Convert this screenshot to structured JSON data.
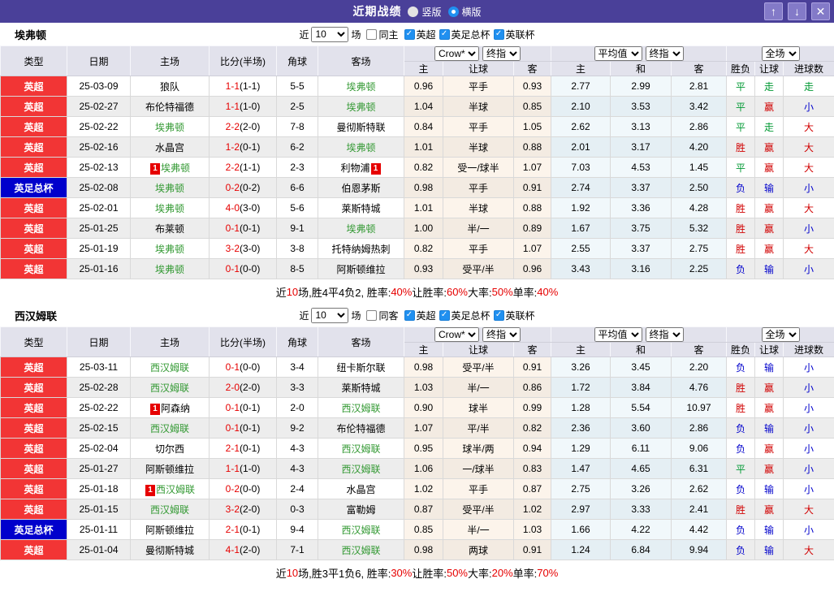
{
  "titlebar": {
    "title": "近期战绩",
    "vertical_label": "竖版",
    "horizontal_label": "横版",
    "vertical_selected": false,
    "horizontal_selected": true,
    "buttons": [
      {
        "name": "scroll-up",
        "glyph": "↑"
      },
      {
        "name": "scroll-down",
        "glyph": "↓"
      },
      {
        "name": "close",
        "glyph": "✕"
      }
    ]
  },
  "table": {
    "main_columns": [
      "类型",
      "日期",
      "主场",
      "比分(半场)",
      "角球",
      "客场"
    ],
    "sub_columns": [
      "主",
      "让球",
      "客",
      "主",
      "和",
      "客",
      "胜负",
      "让球",
      "进球数"
    ],
    "dropdowns": {
      "company": "Crow*",
      "company_type": "终指",
      "average": "平均值",
      "average_type": "终指",
      "scope": "全场"
    }
  },
  "colors": {
    "titlebar_purple": "#4a4099",
    "league_red": "#f23535",
    "cup_blue": "#0000cc",
    "team_green": "#339933",
    "score_red": "#e60000",
    "win_red": "#d10000",
    "draw_green": "#009933",
    "lose_blue": "#0000cc"
  },
  "sections": [
    {
      "team": "埃弗顿",
      "filter": {
        "near": "近",
        "count": "10",
        "unit": "场",
        "same": "同主",
        "same_checked": false,
        "leagues": [
          {
            "label": "英超",
            "checked": true
          },
          {
            "label": "英足总杯",
            "checked": true
          },
          {
            "label": "英联杯",
            "checked": true
          }
        ]
      },
      "rows": [
        {
          "league": "英超",
          "league_color": "red",
          "date": "25-03-09",
          "home": "狼队",
          "home_hl": false,
          "score": "1-1",
          "half": "(1-1)",
          "corner": "5-5",
          "away": "埃弗顿",
          "away_hl": true,
          "odds": [
            "0.96",
            "平手",
            "0.93"
          ],
          "avg": [
            "2.77",
            "2.99",
            "2.81"
          ],
          "results": [
            {
              "t": "平",
              "c": "g"
            },
            {
              "t": "走",
              "c": "g"
            },
            {
              "t": "走",
              "c": "g"
            }
          ]
        },
        {
          "league": "英超",
          "league_color": "red",
          "date": "25-02-27",
          "home": "布伦特福德",
          "home_hl": false,
          "score": "1-1",
          "half": "(1-0)",
          "corner": "2-5",
          "away": "埃弗顿",
          "away_hl": true,
          "odds": [
            "1.04",
            "半球",
            "0.85"
          ],
          "avg": [
            "2.10",
            "3.53",
            "3.42"
          ],
          "results": [
            {
              "t": "平",
              "c": "g"
            },
            {
              "t": "赢",
              "c": "r"
            },
            {
              "t": "小",
              "c": "b"
            }
          ]
        },
        {
          "league": "英超",
          "league_color": "red",
          "date": "25-02-22",
          "home": "埃弗顿",
          "home_hl": true,
          "score": "2-2",
          "half": "(2-0)",
          "corner": "7-8",
          "away": "曼彻斯特联",
          "away_hl": false,
          "odds": [
            "0.84",
            "平手",
            "1.05"
          ],
          "avg": [
            "2.62",
            "3.13",
            "2.86"
          ],
          "results": [
            {
              "t": "平",
              "c": "g"
            },
            {
              "t": "走",
              "c": "g"
            },
            {
              "t": "大",
              "c": "r"
            }
          ]
        },
        {
          "league": "英超",
          "league_color": "red",
          "date": "25-02-16",
          "home": "水晶宫",
          "home_hl": false,
          "score": "1-2",
          "half": "(0-1)",
          "corner": "6-2",
          "away": "埃弗顿",
          "away_hl": true,
          "odds": [
            "1.01",
            "半球",
            "0.88"
          ],
          "avg": [
            "2.01",
            "3.17",
            "4.20"
          ],
          "results": [
            {
              "t": "胜",
              "c": "r"
            },
            {
              "t": "赢",
              "c": "r"
            },
            {
              "t": "大",
              "c": "r"
            }
          ]
        },
        {
          "league": "英超",
          "league_color": "red",
          "date": "25-02-13",
          "home": "埃弗顿",
          "home_hl": true,
          "home_card": "1",
          "score": "2-2",
          "half": "(1-1)",
          "corner": "2-3",
          "away": "利物浦",
          "away_hl": false,
          "away_card": "1",
          "odds": [
            "0.82",
            "受一/球半",
            "1.07"
          ],
          "avg": [
            "7.03",
            "4.53",
            "1.45"
          ],
          "results": [
            {
              "t": "平",
              "c": "g"
            },
            {
              "t": "赢",
              "c": "r"
            },
            {
              "t": "大",
              "c": "r"
            }
          ]
        },
        {
          "league": "英足总杯",
          "league_color": "blue",
          "date": "25-02-08",
          "home": "埃弗顿",
          "home_hl": true,
          "score": "0-2",
          "half": "(0-2)",
          "corner": "6-6",
          "away": "伯恩茅斯",
          "away_hl": false,
          "odds": [
            "0.98",
            "平手",
            "0.91"
          ],
          "avg": [
            "2.74",
            "3.37",
            "2.50"
          ],
          "results": [
            {
              "t": "负",
              "c": "b"
            },
            {
              "t": "输",
              "c": "b"
            },
            {
              "t": "小",
              "c": "b"
            }
          ]
        },
        {
          "league": "英超",
          "league_color": "red",
          "date": "25-02-01",
          "home": "埃弗顿",
          "home_hl": true,
          "score": "4-0",
          "half": "(3-0)",
          "corner": "5-6",
          "away": "莱斯特城",
          "away_hl": false,
          "odds": [
            "1.01",
            "半球",
            "0.88"
          ],
          "avg": [
            "1.92",
            "3.36",
            "4.28"
          ],
          "results": [
            {
              "t": "胜",
              "c": "r"
            },
            {
              "t": "赢",
              "c": "r"
            },
            {
              "t": "大",
              "c": "r"
            }
          ]
        },
        {
          "league": "英超",
          "league_color": "red",
          "date": "25-01-25",
          "home": "布莱顿",
          "home_hl": false,
          "score": "0-1",
          "half": "(0-1)",
          "corner": "9-1",
          "away": "埃弗顿",
          "away_hl": true,
          "odds": [
            "1.00",
            "半/一",
            "0.89"
          ],
          "avg": [
            "1.67",
            "3.75",
            "5.32"
          ],
          "results": [
            {
              "t": "胜",
              "c": "r"
            },
            {
              "t": "赢",
              "c": "r"
            },
            {
              "t": "小",
              "c": "b"
            }
          ]
        },
        {
          "league": "英超",
          "league_color": "red",
          "date": "25-01-19",
          "home": "埃弗顿",
          "home_hl": true,
          "score": "3-2",
          "half": "(3-0)",
          "corner": "3-8",
          "away": "托特纳姆热刺",
          "away_hl": false,
          "odds": [
            "0.82",
            "平手",
            "1.07"
          ],
          "avg": [
            "2.55",
            "3.37",
            "2.75"
          ],
          "results": [
            {
              "t": "胜",
              "c": "r"
            },
            {
              "t": "赢",
              "c": "r"
            },
            {
              "t": "大",
              "c": "r"
            }
          ]
        },
        {
          "league": "英超",
          "league_color": "red",
          "date": "25-01-16",
          "home": "埃弗顿",
          "home_hl": true,
          "score": "0-1",
          "half": "(0-0)",
          "corner": "8-5",
          "away": "阿斯顿维拉",
          "away_hl": false,
          "odds": [
            "0.93",
            "受平/半",
            "0.96"
          ],
          "avg": [
            "3.43",
            "3.16",
            "2.25"
          ],
          "results": [
            {
              "t": "负",
              "c": "b"
            },
            {
              "t": "输",
              "c": "b"
            },
            {
              "t": "小",
              "c": "b"
            }
          ]
        }
      ],
      "summary": [
        {
          "t": "近"
        },
        {
          "t": "10",
          "red": true
        },
        {
          "t": "场,胜4平4负2, 胜率:"
        },
        {
          "t": "40%",
          "red": true
        },
        {
          "t": " 让胜率:"
        },
        {
          "t": "60%",
          "red": true
        },
        {
          "t": " 大率:"
        },
        {
          "t": "50%",
          "red": true
        },
        {
          "t": " 单率:"
        },
        {
          "t": "40%",
          "red": true
        }
      ]
    },
    {
      "team": "西汉姆联",
      "filter": {
        "near": "近",
        "count": "10",
        "unit": "场",
        "same": "同客",
        "same_checked": false,
        "leagues": [
          {
            "label": "英超",
            "checked": true
          },
          {
            "label": "英足总杯",
            "checked": true
          },
          {
            "label": "英联杯",
            "checked": true
          }
        ]
      },
      "rows": [
        {
          "league": "英超",
          "league_color": "red",
          "date": "25-03-11",
          "home": "西汉姆联",
          "home_hl": true,
          "score": "0-1",
          "half": "(0-0)",
          "corner": "3-4",
          "away": "纽卡斯尔联",
          "away_hl": false,
          "odds": [
            "0.98",
            "受平/半",
            "0.91"
          ],
          "avg": [
            "3.26",
            "3.45",
            "2.20"
          ],
          "results": [
            {
              "t": "负",
              "c": "b"
            },
            {
              "t": "输",
              "c": "b"
            },
            {
              "t": "小",
              "c": "b"
            }
          ]
        },
        {
          "league": "英超",
          "league_color": "red",
          "date": "25-02-28",
          "home": "西汉姆联",
          "home_hl": true,
          "score": "2-0",
          "half": "(2-0)",
          "corner": "3-3",
          "away": "莱斯特城",
          "away_hl": false,
          "odds": [
            "1.03",
            "半/一",
            "0.86"
          ],
          "avg": [
            "1.72",
            "3.84",
            "4.76"
          ],
          "results": [
            {
              "t": "胜",
              "c": "r"
            },
            {
              "t": "赢",
              "c": "r"
            },
            {
              "t": "小",
              "c": "b"
            }
          ]
        },
        {
          "league": "英超",
          "league_color": "red",
          "date": "25-02-22",
          "home": "阿森纳",
          "home_hl": false,
          "home_card": "1",
          "score": "0-1",
          "half": "(0-1)",
          "corner": "2-0",
          "away": "西汉姆联",
          "away_hl": true,
          "odds": [
            "0.90",
            "球半",
            "0.99"
          ],
          "avg": [
            "1.28",
            "5.54",
            "10.97"
          ],
          "results": [
            {
              "t": "胜",
              "c": "r"
            },
            {
              "t": "赢",
              "c": "r"
            },
            {
              "t": "小",
              "c": "b"
            }
          ]
        },
        {
          "league": "英超",
          "league_color": "red",
          "date": "25-02-15",
          "home": "西汉姆联",
          "home_hl": true,
          "score": "0-1",
          "half": "(0-1)",
          "corner": "9-2",
          "away": "布伦特福德",
          "away_hl": false,
          "odds": [
            "1.07",
            "平/半",
            "0.82"
          ],
          "avg": [
            "2.36",
            "3.60",
            "2.86"
          ],
          "results": [
            {
              "t": "负",
              "c": "b"
            },
            {
              "t": "输",
              "c": "b"
            },
            {
              "t": "小",
              "c": "b"
            }
          ]
        },
        {
          "league": "英超",
          "league_color": "red",
          "date": "25-02-04",
          "home": "切尔西",
          "home_hl": false,
          "score": "2-1",
          "half": "(0-1)",
          "corner": "4-3",
          "away": "西汉姆联",
          "away_hl": true,
          "odds": [
            "0.95",
            "球半/两",
            "0.94"
          ],
          "avg": [
            "1.29",
            "6.11",
            "9.06"
          ],
          "results": [
            {
              "t": "负",
              "c": "b"
            },
            {
              "t": "赢",
              "c": "r"
            },
            {
              "t": "小",
              "c": "b"
            }
          ]
        },
        {
          "league": "英超",
          "league_color": "red",
          "date": "25-01-27",
          "home": "阿斯顿维拉",
          "home_hl": false,
          "score": "1-1",
          "half": "(1-0)",
          "corner": "4-3",
          "away": "西汉姆联",
          "away_hl": true,
          "odds": [
            "1.06",
            "一/球半",
            "0.83"
          ],
          "avg": [
            "1.47",
            "4.65",
            "6.31"
          ],
          "results": [
            {
              "t": "平",
              "c": "g"
            },
            {
              "t": "赢",
              "c": "r"
            },
            {
              "t": "小",
              "c": "b"
            }
          ]
        },
        {
          "league": "英超",
          "league_color": "red",
          "date": "25-01-18",
          "home": "西汉姆联",
          "home_hl": true,
          "home_card": "1",
          "score": "0-2",
          "half": "(0-0)",
          "corner": "2-4",
          "away": "水晶宫",
          "away_hl": false,
          "odds": [
            "1.02",
            "平手",
            "0.87"
          ],
          "avg": [
            "2.75",
            "3.26",
            "2.62"
          ],
          "results": [
            {
              "t": "负",
              "c": "b"
            },
            {
              "t": "输",
              "c": "b"
            },
            {
              "t": "小",
              "c": "b"
            }
          ]
        },
        {
          "league": "英超",
          "league_color": "red",
          "date": "25-01-15",
          "home": "西汉姆联",
          "home_hl": true,
          "score": "3-2",
          "half": "(2-0)",
          "corner": "0-3",
          "away": "富勒姆",
          "away_hl": false,
          "odds": [
            "0.87",
            "受平/半",
            "1.02"
          ],
          "avg": [
            "2.97",
            "3.33",
            "2.41"
          ],
          "results": [
            {
              "t": "胜",
              "c": "r"
            },
            {
              "t": "赢",
              "c": "r"
            },
            {
              "t": "大",
              "c": "r"
            }
          ]
        },
        {
          "league": "英足总杯",
          "league_color": "blue",
          "date": "25-01-11",
          "home": "阿斯顿维拉",
          "home_hl": false,
          "score": "2-1",
          "half": "(0-1)",
          "corner": "9-4",
          "away": "西汉姆联",
          "away_hl": true,
          "odds": [
            "0.85",
            "半/一",
            "1.03"
          ],
          "avg": [
            "1.66",
            "4.22",
            "4.42"
          ],
          "results": [
            {
              "t": "负",
              "c": "b"
            },
            {
              "t": "输",
              "c": "b"
            },
            {
              "t": "小",
              "c": "b"
            }
          ]
        },
        {
          "league": "英超",
          "league_color": "red",
          "date": "25-01-04",
          "home": "曼彻斯特城",
          "home_hl": false,
          "score": "4-1",
          "half": "(2-0)",
          "corner": "7-1",
          "away": "西汉姆联",
          "away_hl": true,
          "odds": [
            "0.98",
            "两球",
            "0.91"
          ],
          "avg": [
            "1.24",
            "6.84",
            "9.94"
          ],
          "results": [
            {
              "t": "负",
              "c": "b"
            },
            {
              "t": "输",
              "c": "b"
            },
            {
              "t": "大",
              "c": "r"
            }
          ]
        }
      ],
      "summary": [
        {
          "t": "近"
        },
        {
          "t": "10",
          "red": true
        },
        {
          "t": "场,胜3平1负6, 胜率:"
        },
        {
          "t": "30%",
          "red": true
        },
        {
          "t": " 让胜率:"
        },
        {
          "t": "50%",
          "red": true
        },
        {
          "t": " 大率:"
        },
        {
          "t": "20%",
          "red": true
        },
        {
          "t": " 单率:"
        },
        {
          "t": "70%",
          "red": true
        }
      ]
    }
  ]
}
